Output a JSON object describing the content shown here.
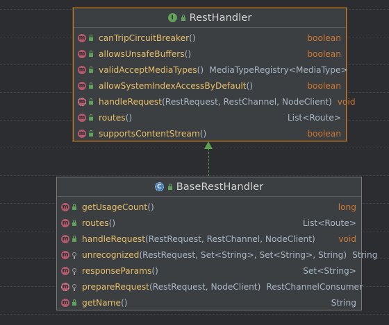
{
  "interface_box": {
    "title": "RestHandler",
    "kind_icon": "interface-icon",
    "methods": [
      {
        "name": "canTripCircuitBreaker",
        "params": "()",
        "ret": "boolean",
        "ret_kw": true,
        "icon": "m",
        "abstract": false,
        "visibility": "public"
      },
      {
        "name": "allowsUnsafeBuffers",
        "params": "()",
        "ret": "boolean",
        "ret_kw": true,
        "icon": "m",
        "abstract": false,
        "visibility": "public"
      },
      {
        "name": "validAcceptMediaTypes",
        "params": "()",
        "ret": "MediaTypeRegistry<MediaType>",
        "ret_kw": false,
        "icon": "m",
        "abstract": false,
        "visibility": "public"
      },
      {
        "name": "allowSystemIndexAccessByDefault",
        "params": "()",
        "ret": "boolean",
        "ret_kw": true,
        "icon": "m",
        "abstract": false,
        "visibility": "public"
      },
      {
        "name": "handleRequest",
        "params": "(RestRequest, RestChannel, NodeClient)",
        "ret": "void",
        "ret_kw": true,
        "icon": "m",
        "abstract": true,
        "visibility": "public"
      },
      {
        "name": "routes",
        "params": "()",
        "ret": "List<Route>",
        "ret_kw": false,
        "icon": "m",
        "abstract": false,
        "visibility": "public"
      },
      {
        "name": "supportsContentStream",
        "params": "()",
        "ret": "boolean",
        "ret_kw": true,
        "icon": "m",
        "abstract": false,
        "visibility": "public"
      }
    ]
  },
  "class_box": {
    "title": "BaseRestHandler",
    "kind_icon": "abstract-class-icon",
    "methods": [
      {
        "name": "getUsageCount",
        "params": "()",
        "ret": "long",
        "ret_kw": true,
        "icon": "m",
        "abstract": false,
        "visibility": "public"
      },
      {
        "name": "routes",
        "params": "()",
        "ret": "List<Route>",
        "ret_kw": false,
        "icon": "m",
        "abstract": false,
        "visibility": "public"
      },
      {
        "name": "handleRequest",
        "params": "(RestRequest, RestChannel, NodeClient)",
        "ret": "void",
        "ret_kw": true,
        "icon": "m",
        "abstract": false,
        "visibility": "public"
      },
      {
        "name": "unrecognized",
        "params": "(RestRequest, Set<String>, Set<String>, String)",
        "ret": "String",
        "ret_kw": false,
        "icon": "m",
        "abstract": false,
        "visibility": "protected"
      },
      {
        "name": "responseParams",
        "params": "()",
        "ret": "Set<String>",
        "ret_kw": false,
        "icon": "m",
        "abstract": false,
        "visibility": "protected"
      },
      {
        "name": "prepareRequest",
        "params": "(RestRequest, NodeClient)",
        "ret": "RestChannelConsumer",
        "ret_kw": false,
        "icon": "m",
        "abstract": true,
        "visibility": "protected"
      },
      {
        "name": "getName",
        "params": "()",
        "ret": "String",
        "ret_kw": false,
        "icon": "m",
        "abstract": false,
        "visibility": "public"
      }
    ]
  },
  "relation": {
    "type": "implements",
    "color": "#5aa14b"
  },
  "colors": {
    "background": "#2b2d30",
    "box": "#3c3f41",
    "method_name": "#e8bf6a",
    "keyword": "#cc7832",
    "type_text": "#a9b7c6",
    "selected_border": "#c57a25"
  }
}
